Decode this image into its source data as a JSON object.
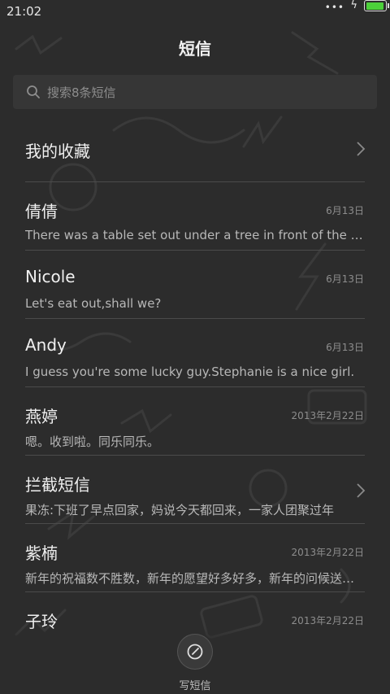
{
  "status_bar": {
    "time": "21:02",
    "dots": "•••",
    "bolt": "ϟ",
    "battery_level": 0.95,
    "battery_color": "#4cd03a"
  },
  "app": {
    "title": "短信"
  },
  "search": {
    "placeholder": "搜索8条短信"
  },
  "favorites": {
    "label": "我的收藏"
  },
  "conversations": [
    {
      "name": "倩倩",
      "date": "6月13日",
      "preview": "There was a table set out under a tree in front of the house",
      "chevron": false
    },
    {
      "name": "Nicole",
      "date": "6月13日",
      "preview": "Let's eat out,shall we?",
      "chevron": false
    },
    {
      "name": "Andy",
      "date": "6月13日",
      "preview": "I guess you're some lucky guy.Stephanie is a nice girl.",
      "chevron": false
    },
    {
      "name": "燕婷",
      "date": "2013年2月22日",
      "preview": "嗯。收到啦。同乐同乐。",
      "chevron": false
    },
    {
      "name": "拦截短信",
      "date": "",
      "preview": "果冻:下班了早点回家，妈说今天都回来，一家人团聚过年",
      "chevron": true
    },
    {
      "name": "紫楠",
      "date": "2013年2月22日",
      "preview": "新年的祝福数不胜数，新年的愿望好多好多，新年的问候送给你",
      "chevron": false
    },
    {
      "name": "子玲",
      "date": "2013年2月22日",
      "preview": "",
      "chevron": false
    }
  ],
  "compose": {
    "label": "写短信",
    "icon": "compose-icon"
  }
}
